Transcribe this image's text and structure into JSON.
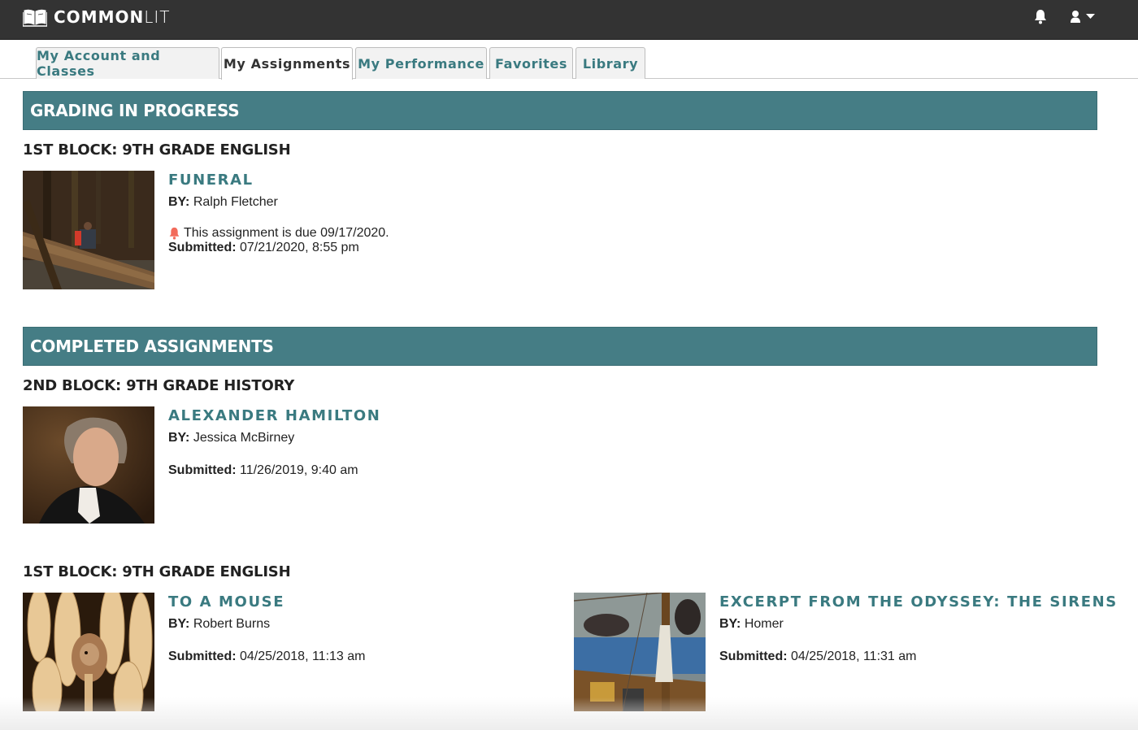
{
  "app": {
    "brand_bold": "COMMON",
    "brand_light": "LIT",
    "icons": {
      "logo": "open-book-icon",
      "notifications": "bell-icon",
      "user": "user-icon",
      "dropdown": "caret-down-icon"
    }
  },
  "tabs": [
    {
      "label": "My Account and Classes",
      "active": false
    },
    {
      "label": "My Assignments",
      "active": true
    },
    {
      "label": "My Performance",
      "active": false
    },
    {
      "label": "Favorites",
      "active": false
    },
    {
      "label": "Library",
      "active": false
    }
  ],
  "colors": {
    "accent": "#457d85",
    "title_teal": "#3a7a80",
    "topbar": "#333333",
    "alert": "#f26b5b"
  },
  "sections": [
    {
      "heading": "GRADING IN PROGRESS",
      "classes": [
        {
          "name": "1ST BLOCK: 9TH GRADE ENGLISH",
          "assignments": [
            {
              "title": "FUNERAL",
              "by_label": "BY:",
              "author": "Ralph Fletcher",
              "due_notice": "This assignment is due 09/17/2020.",
              "submitted_label": "Submitted:",
              "submitted": "07/21/2020, 8:55 pm",
              "image": "boy sitting on fallen log in forest"
            }
          ]
        }
      ]
    },
    {
      "heading": "COMPLETED ASSIGNMENTS",
      "classes": [
        {
          "name": "2ND BLOCK: 9TH GRADE HISTORY",
          "assignments": [
            {
              "title": "ALEXANDER HAMILTON",
              "by_label": "BY:",
              "author": "Jessica McBirney",
              "submitted_label": "Submitted:",
              "submitted": "11/26/2019, 9:40 am",
              "image": "portrait of Alexander Hamilton"
            }
          ]
        },
        {
          "name": "1ST BLOCK: 9TH GRADE ENGLISH",
          "assignments": [
            {
              "title": "TO A MOUSE",
              "by_label": "BY:",
              "author": "Robert Burns",
              "submitted_label": "Submitted:",
              "submitted": "04/25/2018, 11:13 am",
              "image": "mouse among wheat stalks"
            },
            {
              "title": "EXCERPT FROM THE ODYSSEY: THE SIRENS",
              "by_label": "BY:",
              "author": "Homer",
              "submitted_label": "Submitted:",
              "submitted": "04/25/2018, 11:31 am",
              "image": "painting of Ulysses and the Sirens"
            }
          ]
        }
      ]
    }
  ]
}
